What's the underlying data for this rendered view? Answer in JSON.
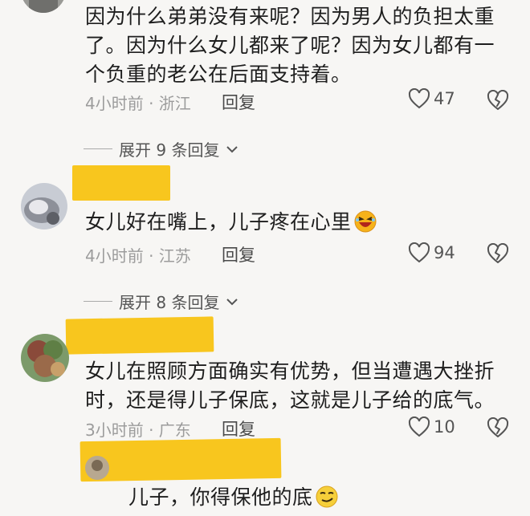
{
  "comments": [
    {
      "lines": [
        "因为什么弟弟没有来呢？因为男人的负担太重",
        "了。因为什么女儿都来了呢？因为女儿都有一",
        "个负重的老公在后面支持着。"
      ],
      "time_location": "4小时前 · 浙江",
      "reply_label": "回复",
      "likes": "47"
    },
    {
      "lines": [
        "女儿好在嘴上，儿子疼在心里"
      ],
      "time_location": "4小时前 · 江苏",
      "reply_label": "回复",
      "likes": "94"
    },
    {
      "lines": [
        "女儿在照顾方面确实有优势，但当遭遇大挫折",
        "时，还是得儿子保底，这就是儿子给的底气。"
      ],
      "time_location": "3小时前 · 广东",
      "reply_label": "回复",
      "likes": "10"
    },
    {
      "lines": [
        "儿子，你得保他的底"
      ]
    }
  ],
  "expanders": [
    {
      "label": "展开 9 条回复"
    },
    {
      "label": "展开 8 条回复"
    }
  ],
  "colors": {
    "redaction": "#f8c61e",
    "background": "#f7f6f4"
  },
  "icons": [
    "heart-outline-icon",
    "broken-heart-icon",
    "chevron-down-icon",
    "laughing-emoji-icon",
    "smirk-emoji-icon"
  ]
}
